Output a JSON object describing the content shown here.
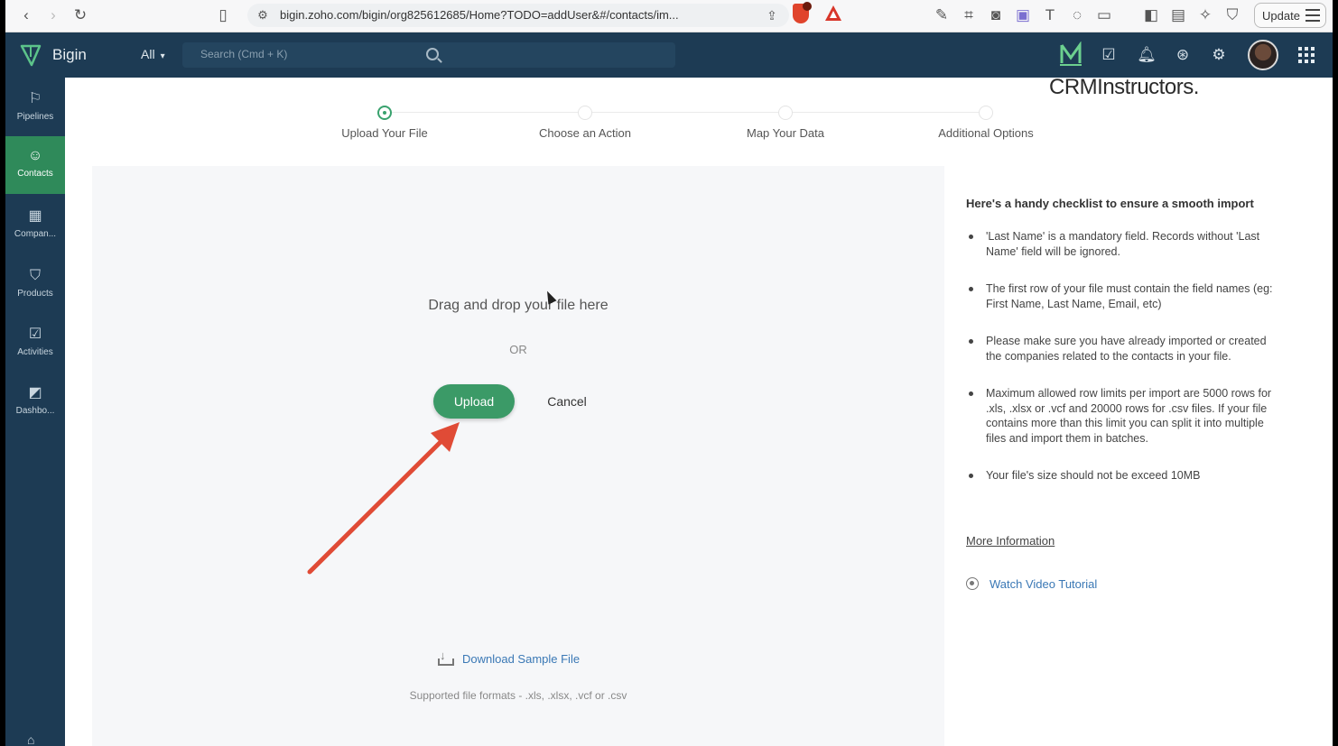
{
  "browser": {
    "url": "bigin.zoho.com/bigin/org825612685/Home?TODO=addUser&#/contacts/im...",
    "update_label": "Update"
  },
  "header": {
    "brand": "Bigin",
    "scope": "All",
    "search_placeholder": "Search (Cmd + K)"
  },
  "sidebar": {
    "items": [
      {
        "label": "Pipelines",
        "icon": "pipelines-icon"
      },
      {
        "label": "Contacts",
        "icon": "contacts-icon",
        "active": true
      },
      {
        "label": "Compan...",
        "icon": "companies-icon"
      },
      {
        "label": "Products",
        "icon": "products-icon"
      },
      {
        "label": "Activities",
        "icon": "activities-icon"
      },
      {
        "label": "Dashbo...",
        "icon": "dashboards-icon"
      }
    ]
  },
  "stepper": {
    "steps": [
      {
        "label": "Upload Your File",
        "active": true
      },
      {
        "label": "Choose an Action"
      },
      {
        "label": "Map Your Data"
      },
      {
        "label": "Additional Options"
      }
    ],
    "watermark": "CRMInstructors."
  },
  "dropzone": {
    "drag_text": "Drag and drop your file here",
    "or_text": "OR",
    "upload_label": "Upload",
    "cancel_label": "Cancel",
    "download_label": "Download Sample File",
    "formats_text": "Supported file formats - .xls, .xlsx, .vcf or .csv"
  },
  "checklist": {
    "title": "Here's a handy checklist to ensure a smooth import",
    "items": [
      "'Last Name' is a mandatory field. Records without 'Last Name' field will be ignored.",
      "The first row of your file must contain the field names (eg: First Name, Last Name, Email, etc)",
      "Please make sure you have already imported or created the companies related to the contacts in your file.",
      "Maximum allowed row limits per import are 5000 rows for .xls, .xlsx or .vcf and 20000 rows for .csv files. If your file contains more than this limit you can split it into multiple files and import them in batches.",
      "Your file's size should not be exceed 10MB"
    ],
    "more_info": "More Information",
    "video_label": "Watch Video Tutorial"
  },
  "colors": {
    "header_bg": "#1d3b54",
    "accent_green": "#3b9a67",
    "annotation_arrow": "#e04b36"
  }
}
